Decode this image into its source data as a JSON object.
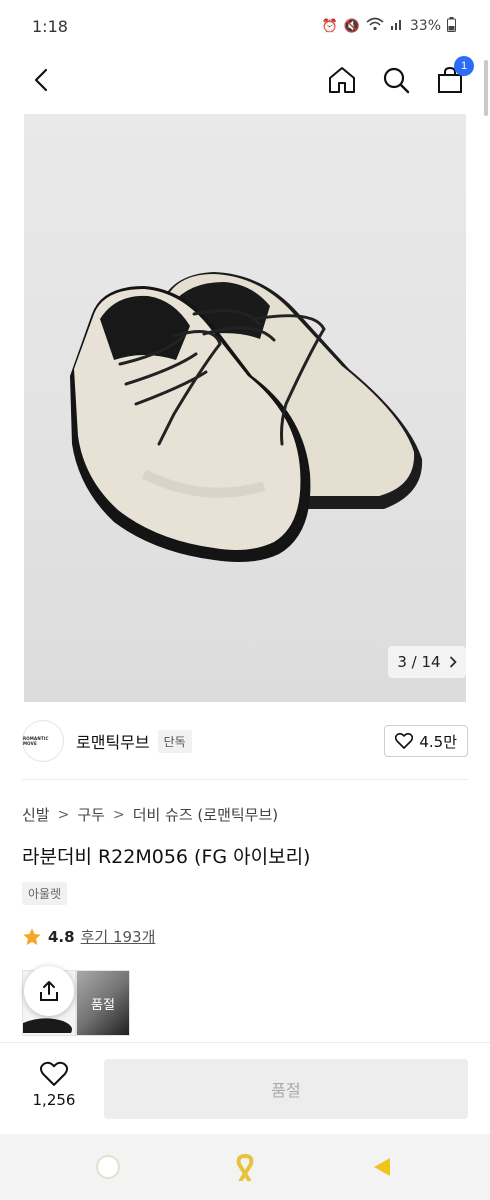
{
  "status_bar": {
    "time": "1:18",
    "battery": "33%"
  },
  "image_counter": {
    "text": "3 / 14"
  },
  "cart": {
    "badge_count": "1"
  },
  "brand": {
    "logo_text": "ROMANTIC MOVE",
    "name": "로맨틱무브",
    "tag": "단독",
    "likes": "4.5만"
  },
  "breadcrumb": [
    "신발",
    "구두",
    "더비 슈즈 (로맨틱무브)"
  ],
  "product": {
    "title": "라분더비 R22M056 (FG 아이보리)",
    "outlet_tag": "아울렛"
  },
  "rating": {
    "value": "4.8",
    "reviews": "후기 193개"
  },
  "thumbnails": [
    {
      "label": ""
    },
    {
      "label": "품절"
    }
  ],
  "bottom_bar": {
    "wish_count": "1,256",
    "action_label": "품절"
  },
  "colors": {
    "accent": "#2d6df6",
    "star": "#f5a623",
    "ribbon": "#e8c23c",
    "sysnav_back": "#f0c419"
  }
}
